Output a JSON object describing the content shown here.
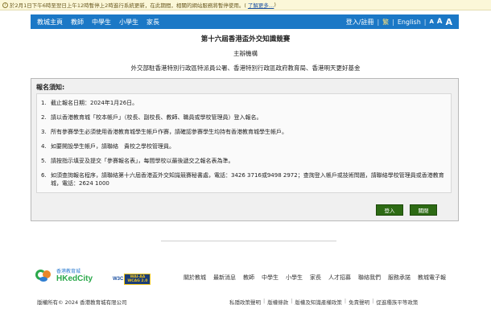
{
  "notice": {
    "text": "於2月1日下午6時至翌日上午12時暫停上2時進行系統更新，在此期間，相關的網站服務將暫停使用。(",
    "more": "了解更多…",
    "close": ")"
  },
  "nav": {
    "items": [
      "教城主頁",
      "教師",
      "中學生",
      "小學生",
      "家長"
    ],
    "login": "登入/註冊",
    "lang_trad": "繁",
    "lang_en": "English",
    "font_small": "A",
    "font_medium": "A",
    "font_large": "A"
  },
  "header": {
    "title": "第十六屆香港盃外交知識競賽",
    "organizer_label": "主辦機構",
    "organizers": "外交部駐香港特別行政區特派員公署、香港特別行政區政府教育局、香港明天更好基金"
  },
  "panel": {
    "title": "報名須知:",
    "items": [
      {
        "num": "1.",
        "text": "截止報名日期：2024年1月26日。"
      },
      {
        "num": "2.",
        "text": "請以香港教育城「校本帳戶」（校長、副校長、教師、職員或學校管理員）登入報名。"
      },
      {
        "num": "3.",
        "text": "所有參賽學生必須使用香港教育城學生帳戶作賽，請確認參賽學生均持有香港教育城學生帳戶。"
      },
      {
        "num": "4.",
        "text": "如要開設學生帳戶，請聯絡　貴校之學校管理員。"
      },
      {
        "num": "5.",
        "text": "請按指示填妥及提交「參賽報名表」，每間學校以最後遞交之報名表為準。"
      },
      {
        "num": "6.",
        "text": "如須查詢報名程序，請聯絡第十六屆香港盃外交知識競賽秘書處，電話：3426 3716或9498 2972；查詢登入帳戶或技術問題，請聯絡學校管理員或香港教育城，電話：2624 1000"
      }
    ],
    "login_button": "登入",
    "close_button": "關閉"
  },
  "footer": {
    "logo_zh": "香港教育城",
    "logo_en": "HKedCity",
    "w3c": "W3C",
    "wai_line1": "WAI-AA",
    "wai_line2": "WCAG 2.0",
    "links": [
      "關於教城",
      "最新消息",
      "教師",
      "中學生",
      "小學生",
      "家長",
      "人才招募",
      "聯絡我們",
      "服務承諾",
      "教城電子報"
    ],
    "copyright": "版權所有© 2024 香港教育城有限公司",
    "policy_links": [
      "私隱政策聲明",
      "版權條款",
      "版權及知識產權政策",
      "免責聲明",
      "促進種族平等政策"
    ]
  },
  "colors": {
    "nav_blue": "#1b78c6",
    "button_green": "#2d6a14",
    "panel_bg": "#f0f0f0"
  }
}
